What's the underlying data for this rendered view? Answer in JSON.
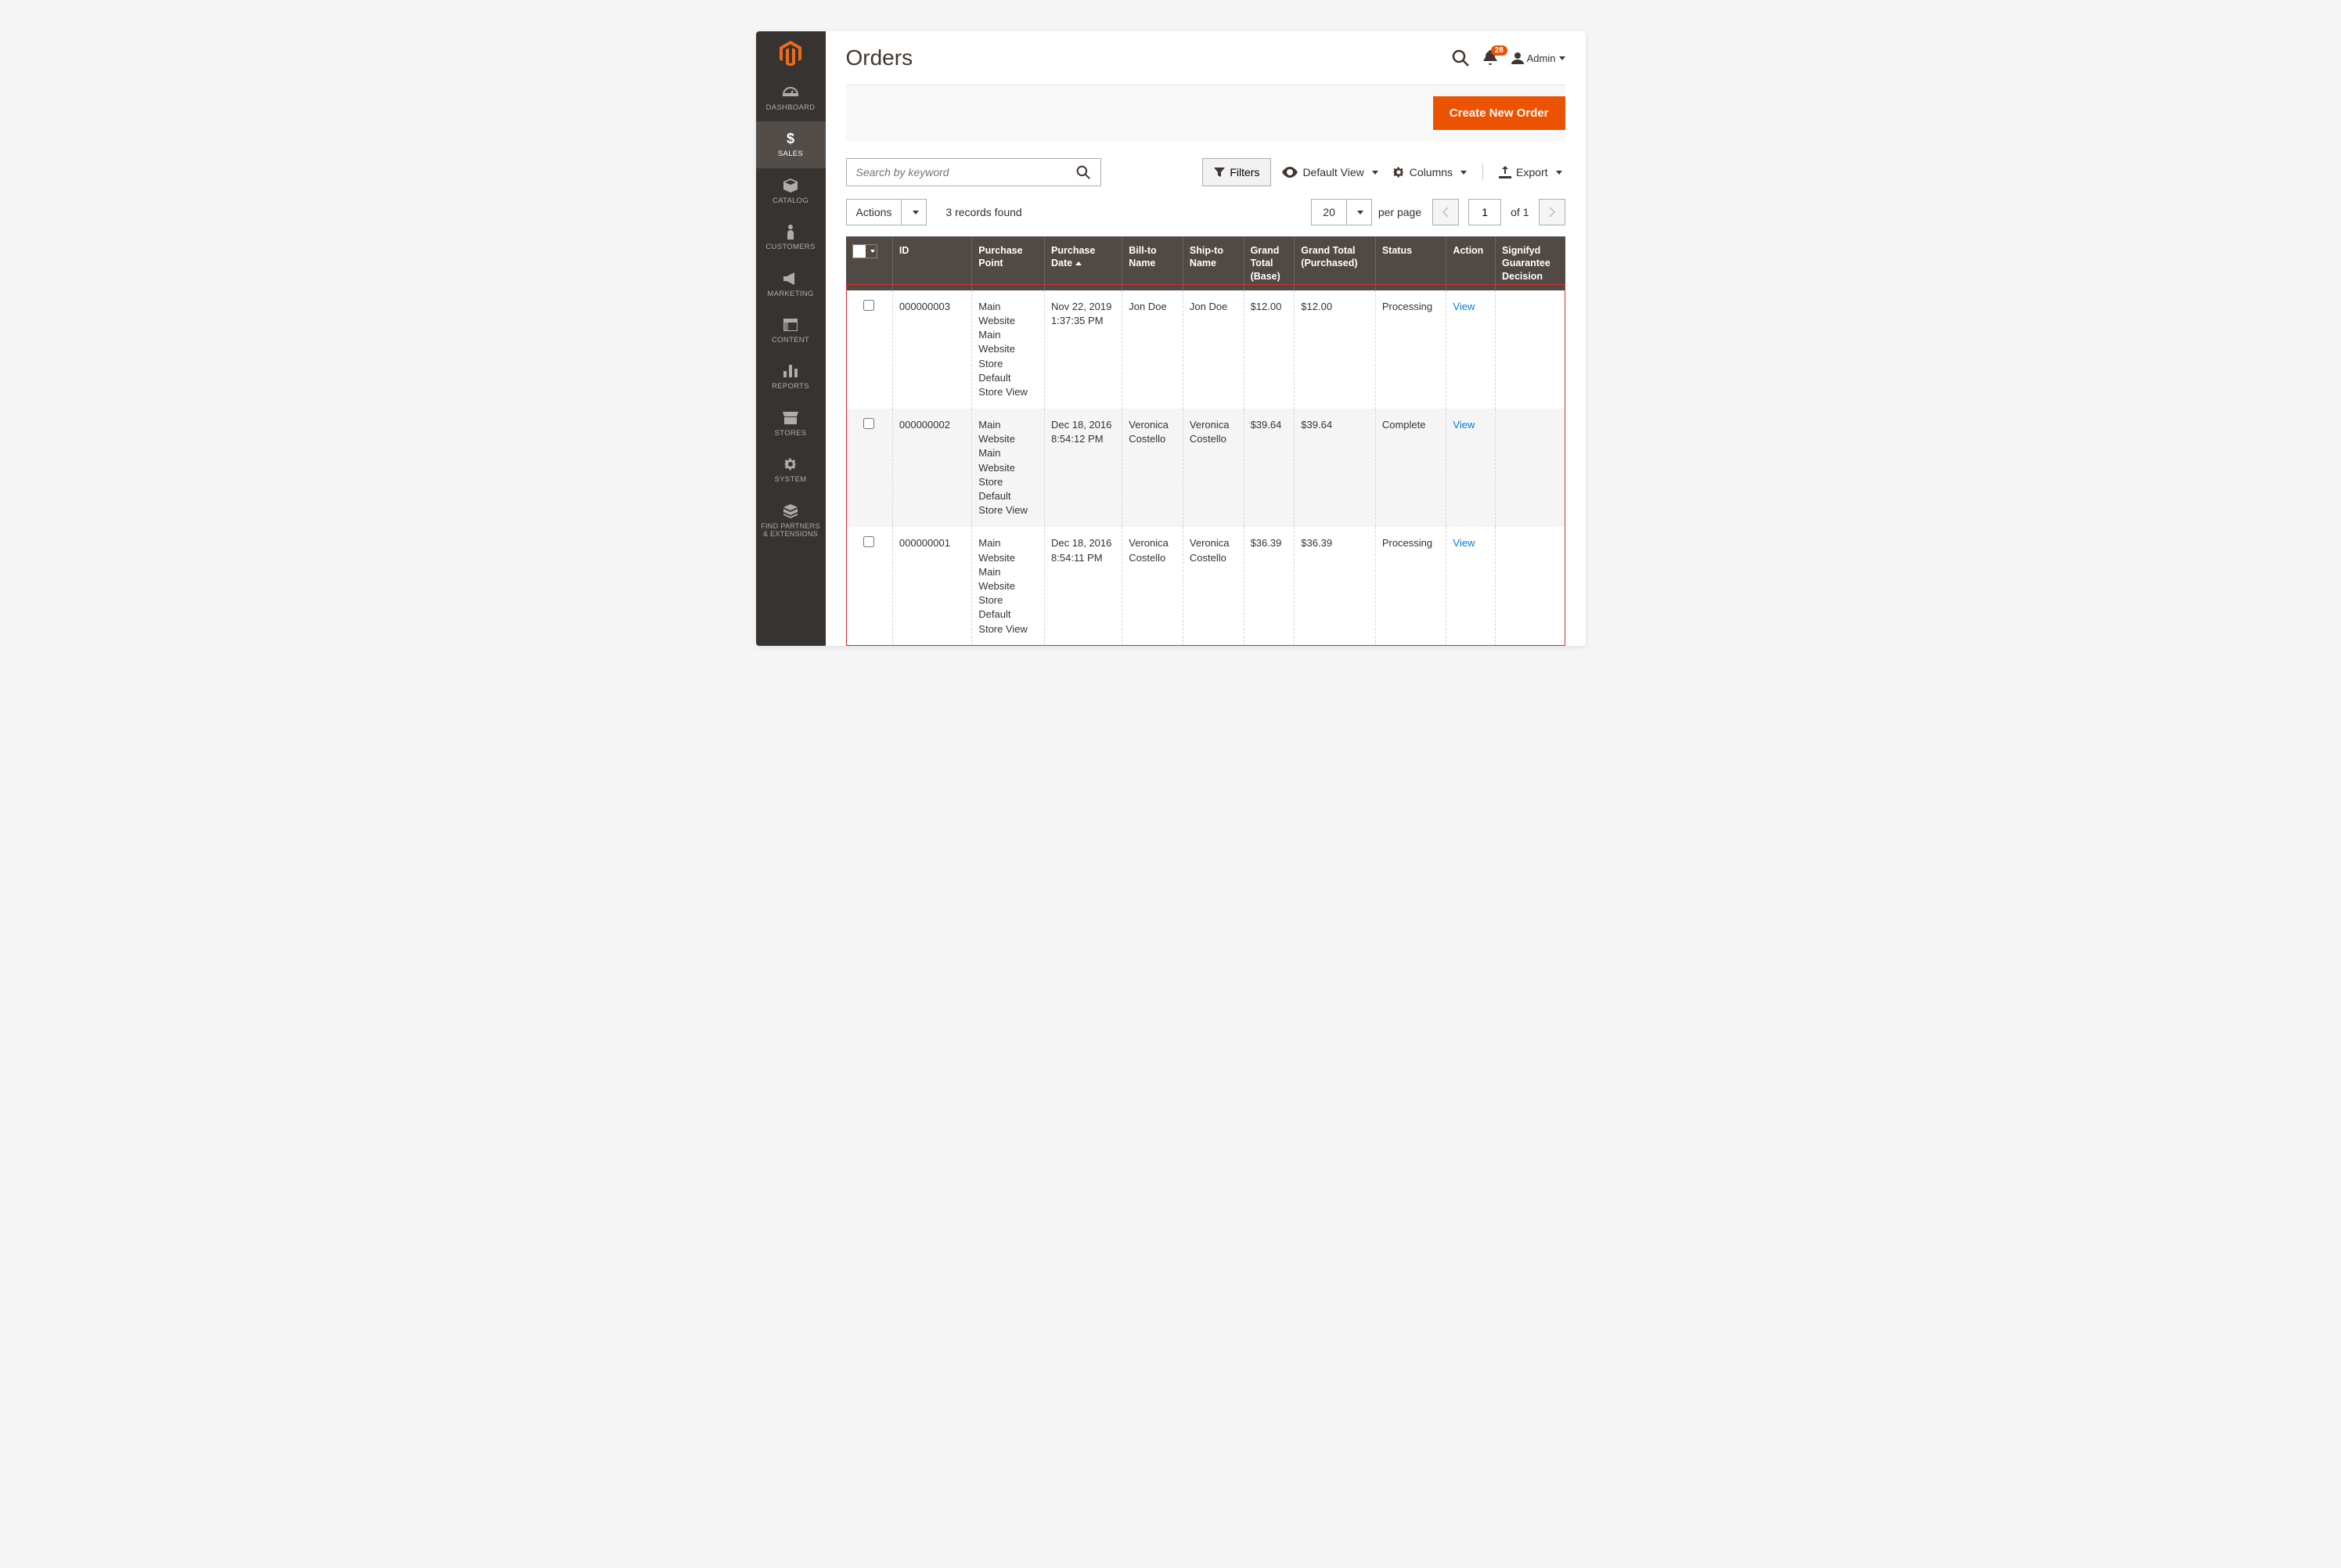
{
  "sidebar": {
    "items": [
      {
        "key": "dashboard",
        "label": "DASHBOARD"
      },
      {
        "key": "sales",
        "label": "SALES"
      },
      {
        "key": "catalog",
        "label": "CATALOG"
      },
      {
        "key": "customers",
        "label": "CUSTOMERS"
      },
      {
        "key": "marketing",
        "label": "MARKETING"
      },
      {
        "key": "content",
        "label": "CONTENT"
      },
      {
        "key": "reports",
        "label": "REPORTS"
      },
      {
        "key": "stores",
        "label": "STORES"
      },
      {
        "key": "system",
        "label": "SYSTEM"
      },
      {
        "key": "partners",
        "label": "FIND PARTNERS & EXTENSIONS"
      }
    ]
  },
  "header": {
    "title": "Orders",
    "notif_count": "28",
    "user": "Admin"
  },
  "actions": {
    "create": "Create New Order"
  },
  "toolbar": {
    "search_placeholder": "Search by keyword",
    "filters": "Filters",
    "default_view": "Default View",
    "columns": "Columns",
    "export": "Export"
  },
  "listbar": {
    "actions": "Actions",
    "records_found": "3 records found",
    "page_size": "20",
    "per_page": "per page",
    "page": "1",
    "of": "of 1"
  },
  "columns": {
    "id": "ID",
    "purchase_point": "Purchase Point",
    "purchase_date": "Purchase Date",
    "bill_to": "Bill-to Name",
    "ship_to": "Ship-to Name",
    "grand_base": "Grand Total (Base)",
    "grand_purch": "Grand Total (Purchased)",
    "status": "Status",
    "action": "Action",
    "signifyd": "Signifyd Guarantee Decision"
  },
  "rows": [
    {
      "id": "000000003",
      "purchase_point": "Main Website\n   Main Website Store\n      Default Store View",
      "purchase_date": "Nov 22, 2019 1:37:35 PM",
      "bill_to": "Jon Doe",
      "ship_to": "Jon Doe",
      "grand_base": "$12.00",
      "grand_purch": "$12.00",
      "status": "Processing",
      "action": "View",
      "signifyd": ""
    },
    {
      "id": "000000002",
      "purchase_point": "Main Website\n   Main Website Store\n      Default Store View",
      "purchase_date": "Dec 18, 2016 8:54:12 PM",
      "bill_to": "Veronica Costello",
      "ship_to": "Veronica Costello",
      "grand_base": "$39.64",
      "grand_purch": "$39.64",
      "status": "Complete",
      "action": "View",
      "signifyd": ""
    },
    {
      "id": "000000001",
      "purchase_point": "Main Website\n   Main Website Store\n      Default Store View",
      "purchase_date": "Dec 18, 2016 8:54:11 PM",
      "bill_to": "Veronica Costello",
      "ship_to": "Veronica Costello",
      "grand_base": "$36.39",
      "grand_purch": "$36.39",
      "status": "Processing",
      "action": "View",
      "signifyd": ""
    }
  ]
}
